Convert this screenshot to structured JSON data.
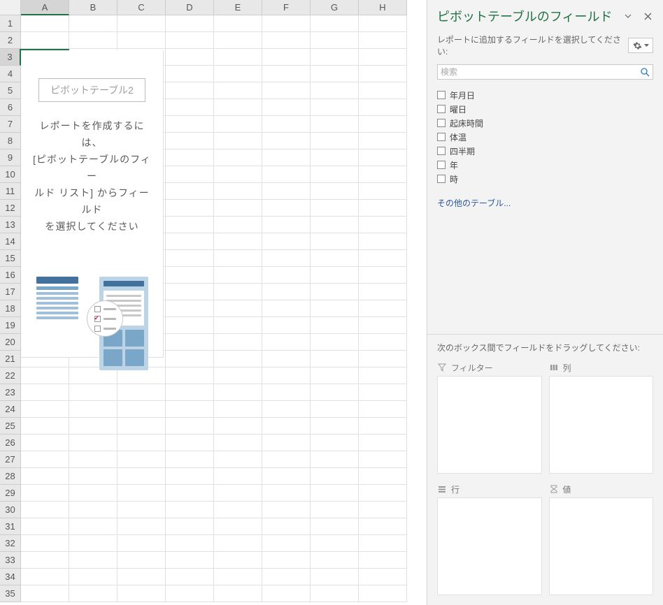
{
  "sheet": {
    "columns": [
      "A",
      "B",
      "C",
      "D",
      "E",
      "F",
      "G",
      "H"
    ],
    "row_count": 35,
    "active_col_index": 0,
    "active_row_index": 2
  },
  "pivot_placeholder": {
    "title": "ピボットテーブル2",
    "line1": "レポートを作成するには、",
    "line2": "[ピボットテーブルのフィー",
    "line3": "ルド リスト] からフィールド",
    "line4": "を選択してください"
  },
  "panel": {
    "title": "ピボットテーブルのフィールド",
    "subtitle": "レポートに追加するフィールドを選択してください:",
    "search_placeholder": "検索",
    "fields": [
      {
        "label": "年月日",
        "checked": false
      },
      {
        "label": "曜日",
        "checked": false
      },
      {
        "label": "起床時間",
        "checked": false
      },
      {
        "label": "体温",
        "checked": false
      },
      {
        "label": "四半期",
        "checked": false
      },
      {
        "label": "年",
        "checked": false
      },
      {
        "label": "時",
        "checked": false
      }
    ],
    "other_tables": "その他のテーブル...",
    "drag_instructions": "次のボックス間でフィールドをドラッグしてください:",
    "zones": {
      "filter": "フィルター",
      "columns": "列",
      "rows": "行",
      "values": "値"
    }
  }
}
